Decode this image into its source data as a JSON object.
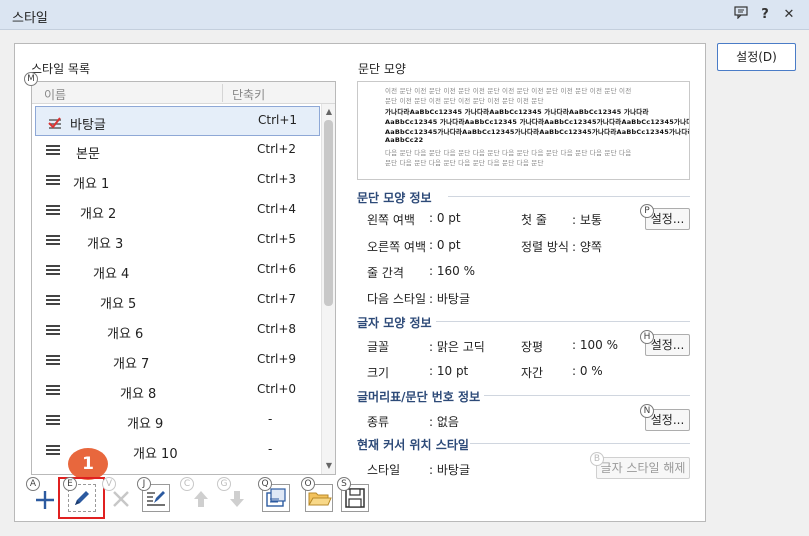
{
  "window": {
    "title": "스타일"
  },
  "titlebar": {
    "help_glyph": "?",
    "close_glyph": "✕"
  },
  "left": {
    "label": "스타일 목록",
    "shortcut_letter": "M",
    "columns": {
      "name": "이름",
      "key": "단축키"
    },
    "rows": [
      {
        "name": "바탕글",
        "key": "Ctrl+1",
        "indent": 0
      },
      {
        "name": "본문",
        "key": "Ctrl+2",
        "indent": 1
      },
      {
        "name": "개요 1",
        "key": "Ctrl+3",
        "indent": 0
      },
      {
        "name": "개요 2",
        "key": "Ctrl+4",
        "indent": 1
      },
      {
        "name": "개요 3",
        "key": "Ctrl+5",
        "indent": 2
      },
      {
        "name": "개요 4",
        "key": "Ctrl+6",
        "indent": 3
      },
      {
        "name": "개요 5",
        "key": "Ctrl+7",
        "indent": 4
      },
      {
        "name": "개요 6",
        "key": "Ctrl+8",
        "indent": 5
      },
      {
        "name": "개요 7",
        "key": "Ctrl+9",
        "indent": 6
      },
      {
        "name": "개요 8",
        "key": "Ctrl+0",
        "indent": 7
      },
      {
        "name": "개요 9",
        "key": "-",
        "indent": 8
      },
      {
        "name": "개요 10",
        "key": "-",
        "indent": 9
      }
    ]
  },
  "toolbar": {
    "letters": [
      "A",
      "E",
      "V",
      "J",
      "C",
      "G",
      "Q",
      "O",
      "S"
    ],
    "badge": "1"
  },
  "right": {
    "preview_label": "문단 모양",
    "preview_lines": [
      "이전 문단 이전 문단 이전 문단 이전 문단 이전 문단 이전 문단 이전 문단 이전 문단 이전",
      "문단 이전 문단 이전 문단 이전 문단 이전 문단 이전 문단",
      "가나다라AaBbCc12345 가나다라AaBbCc12345 가나다라AaBbCc12345 가나다라",
      "AaBbCc12345 가나다라AaBbCc12345 가나다라AaBbCc12345가나다라AaBbCc12345가나다라",
      "AaBbCc12345가나다라AaBbCc12345가나다라AaBbCc12345가나다라AaBbCc12345가나다라",
      "AaBbCc22",
      "다음 문단 다음 문단 다음 문단 다음 문단 다음 문단 다음 문단 다음 문단 다음 문단 다음",
      "문단 다음 문단 다음 문단 다음 문단 다음 문단 다음 문단"
    ],
    "para_info": {
      "title": "문단 모양 정보",
      "left_margin_label": "왼쪽 여백",
      "left_margin": ": 0 pt",
      "first_line_label": "첫 줄",
      "first_line": ": 보통",
      "right_margin_label": "오른쪽 여백",
      "right_margin": ": 0 pt",
      "align_label": "정렬 방식",
      "align": ": 양쪽",
      "line_spacing_label": "줄 간격",
      "line_spacing": ": 160 %",
      "next_style_label": "다음 스타일",
      "next_style": ": 바탕글",
      "settings_label": "설정...",
      "shortcut": "P"
    },
    "char_info": {
      "title": "글자 모양 정보",
      "font_label": "글꼴",
      "font": ": 맑은 고딕",
      "ratio_label": "장평",
      "ratio": ": 100 %",
      "size_label": "크기",
      "size": ": 10 pt",
      "spacing_label": "자간",
      "spacing": ": 0 %",
      "settings_label": "설정...",
      "shortcut": "H"
    },
    "bullet_info": {
      "title": "글머리표/문단 번호 정보",
      "type_label": "종류",
      "type": ": 없음",
      "settings_label": "설정...",
      "shortcut": "N"
    },
    "cursor_info": {
      "title": "현재 커서 위치 스타일",
      "style_label": "스타일",
      "style": ": 바탕글",
      "release_label": "글자 스타일 해제",
      "shortcut": "B"
    }
  },
  "side_button": {
    "label": "설정(D)"
  }
}
